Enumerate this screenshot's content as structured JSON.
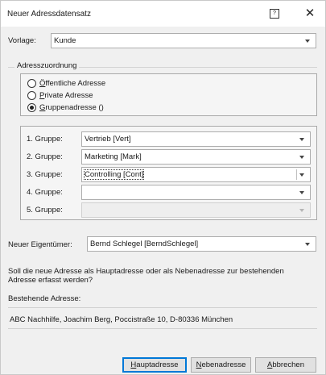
{
  "window": {
    "title": "Neuer Adressdatensatz",
    "help_glyph": "?",
    "close_glyph": "✕"
  },
  "vorlage": {
    "label": "Vorlage:",
    "value": "Kunde"
  },
  "adresszuordnung": {
    "title": "Adresszuordnung",
    "options": [
      {
        "first": "Ö",
        "rest": "ffentliche Adresse",
        "checked": false
      },
      {
        "first": "P",
        "rest": "rivate Adresse",
        "checked": false
      },
      {
        "first": "G",
        "rest": "ruppenadresse ()",
        "checked": true
      }
    ]
  },
  "gruppen": [
    {
      "label": "1. Gruppe:",
      "value": "Vertrieb [Vert]",
      "enabled": true,
      "focused": false
    },
    {
      "label": "2. Gruppe:",
      "value": "Marketing [Mark]",
      "enabled": true,
      "focused": false
    },
    {
      "label": "3. Gruppe:",
      "value": "Controlling [Cont]",
      "enabled": true,
      "focused": true
    },
    {
      "label": "4. Gruppe:",
      "value": "",
      "enabled": true,
      "focused": false
    },
    {
      "label": "5. Gruppe:",
      "value": "",
      "enabled": false,
      "focused": false
    }
  ],
  "eigentuemer": {
    "label": "Neuer Eigentümer:",
    "value": "Bernd Schlegel [BerndSchlegel]"
  },
  "question": {
    "line1": "Soll die neue Adresse als Hauptadresse oder als Nebenadresse zur bestehenden",
    "line2": "Adresse erfasst werden?"
  },
  "bestehende": {
    "label": "Bestehende Adresse:",
    "value": "ABC Nachhilfe, Joachim Berg, Poccistraße 10, D-80336 München"
  },
  "buttons": {
    "haupt": {
      "first": "H",
      "rest": "auptadresse"
    },
    "neben": {
      "first": "N",
      "rest": "ebenadresse"
    },
    "abbrechen": {
      "first": "A",
      "rest": "bbrechen"
    }
  },
  "colors": {
    "accent": "#0078d7",
    "background": "#f0f0f0"
  }
}
